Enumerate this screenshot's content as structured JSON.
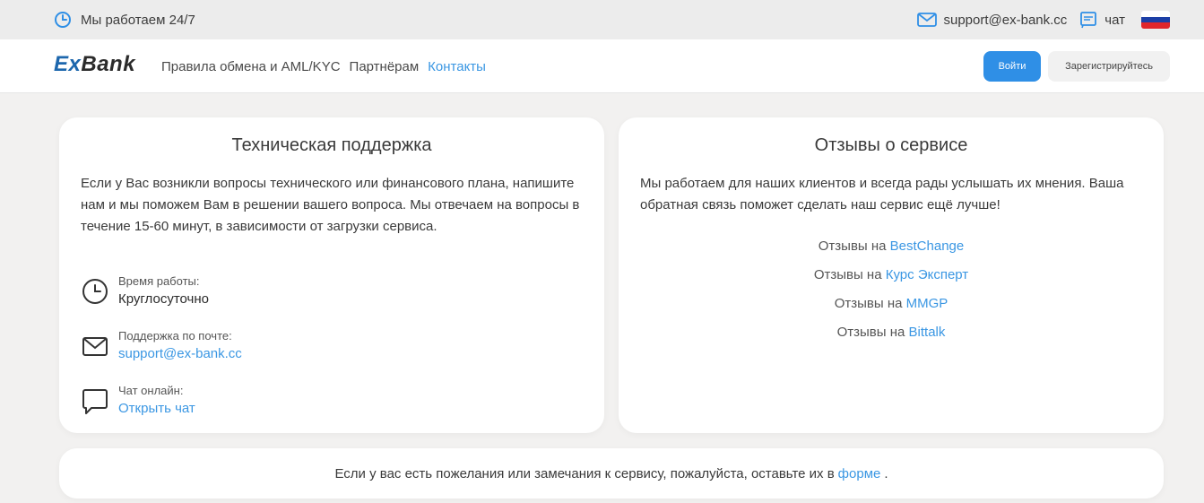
{
  "topbar": {
    "hours": "Мы работаем 24/7",
    "email": "support@ex-bank.cc",
    "chat": "чат",
    "flag_colors": [
      "#ffffff",
      "#1c3fa6",
      "#e0262c"
    ]
  },
  "header": {
    "logo_ex": "Ex",
    "logo_bank": "Bank",
    "nav": [
      "Правила обмена и AML/KYC",
      "Партнёрам",
      "Контакты"
    ],
    "login": "Войти",
    "register": "Зарегистрируйтесь"
  },
  "support": {
    "title": "Техническая поддержка",
    "description": "Если у Вас возникли вопросы технического или финансового плана, напишите нам и мы поможем Вам в решении вашего вопроса. Мы отвечаем на вопросы в течение 15-60 минут, в зависимости от загрузки сервиса.",
    "hours_label": "Время работы:",
    "hours_value": "Круглосуточно",
    "email_label": "Поддержка по почте:",
    "email_value": "support@ex-bank.cc",
    "chat_label": "Чат онлайн:",
    "chat_value": "Открыть чат"
  },
  "reviews": {
    "title": "Отзывы о сервисе",
    "description": "Мы работаем для наших клиентов и всегда рады услышать их мнения. Ваша обратная связь поможет сделать наш сервис ещё лучше!",
    "prefix": "Отзывы на",
    "sites": [
      "BestChange",
      "Курс Эксперт",
      "MMGP",
      "Bittalk"
    ]
  },
  "feedback": {
    "text": "Если у вас есть пожелания или замечания к сервису, пожалуйста, оставьте их в",
    "link": "форме",
    "suffix": "."
  },
  "colors": {
    "accent": "#3b97e3",
    "button": "#2f8fe6",
    "logo": "#1d67ad"
  }
}
